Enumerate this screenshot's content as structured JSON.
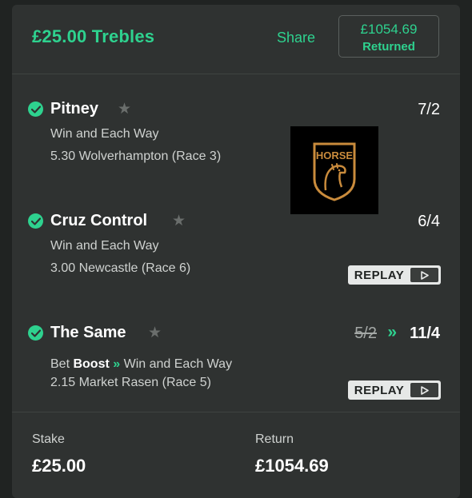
{
  "header": {
    "bet_title": "£25.00 Trebles",
    "share_label": "Share",
    "returned_amount": "£1054.69",
    "returned_label": "Returned"
  },
  "selections": [
    {
      "name": "Pitney",
      "odds": "7/2",
      "market": "Win and Each Way",
      "race": "5.30 Wolverhampton (Race 3)",
      "status": "won"
    },
    {
      "name": "Cruz Control",
      "odds": "6/4",
      "market": "Win and Each Way",
      "race": "3.00 Newcastle (Race 6)",
      "status": "won",
      "replay_label": "REPLAY"
    },
    {
      "name": "The Same",
      "old_odds": "5/2",
      "odds": "11/4",
      "boost_prefix": "Bet",
      "boost_word": "Boost",
      "market": "Win and Each Way",
      "race": "2.15 Market Rasen (Race 5)",
      "status": "won",
      "replay_label": "REPLAY"
    }
  ],
  "ad_logo": {
    "text": "HORSE",
    "color": "#c98b3c"
  },
  "footer": {
    "stake_label": "Stake",
    "stake_value": "£25.00",
    "return_label": "Return",
    "return_value": "£1054.69"
  },
  "colors": {
    "accent": "#2ed28f",
    "card_bg": "#2f3231",
    "page_bg": "#202322"
  },
  "icons": [
    "check-circle-icon",
    "star-icon",
    "boost-arrow-icon",
    "play-icon"
  ]
}
